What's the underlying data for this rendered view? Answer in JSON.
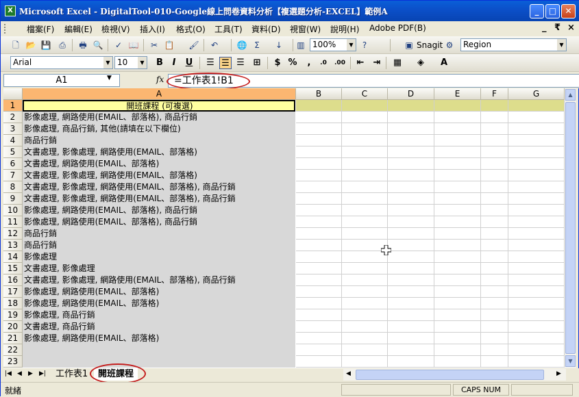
{
  "window": {
    "title": "Microsoft Excel - DigitalTool-010-Google線上問卷資料分析【複選題分析-EXCEL】範例A",
    "app_icon": "excel-icon"
  },
  "menubar": {
    "items": [
      "檔案(F)",
      "編輯(E)",
      "檢視(V)",
      "插入(I)",
      "格式(O)",
      "工具(T)",
      "資料(D)",
      "視窗(W)",
      "說明(H)",
      "Adobe PDF(B)"
    ],
    "right_controls": [
      "_",
      "₹",
      "×"
    ]
  },
  "standard_toolbar": {
    "zoom": "100%",
    "snagit_label": "Snagit",
    "region_combo": "Region"
  },
  "format_toolbar": {
    "font": "Arial",
    "font_size": "10"
  },
  "formula_bar": {
    "name_box": "A1",
    "fx_label": "fx",
    "formula": "=工作表1!B1"
  },
  "grid": {
    "columns": [
      "A",
      "B",
      "C",
      "D",
      "E",
      "F",
      "G"
    ],
    "rows": [
      {
        "num": "1",
        "a": "開班課程 (可複選)"
      },
      {
        "num": "2",
        "a": "影像處理, 網路使用(EMAIL、部落格), 商品行銷"
      },
      {
        "num": "3",
        "a": "影像處理, 商品行銷, 其他(請填在以下欄位)"
      },
      {
        "num": "4",
        "a": "商品行銷"
      },
      {
        "num": "5",
        "a": "文書處理, 影像處理, 網路使用(EMAIL、部落格)"
      },
      {
        "num": "6",
        "a": "文書處理, 網路使用(EMAIL、部落格)"
      },
      {
        "num": "7",
        "a": "文書處理, 影像處理, 網路使用(EMAIL、部落格)"
      },
      {
        "num": "8",
        "a": "文書處理, 影像處理, 網路使用(EMAIL、部落格), 商品行銷"
      },
      {
        "num": "9",
        "a": "文書處理, 影像處理, 網路使用(EMAIL、部落格), 商品行銷"
      },
      {
        "num": "10",
        "a": "影像處理, 網路使用(EMAIL、部落格), 商品行銷"
      },
      {
        "num": "11",
        "a": "影像處理, 網路使用(EMAIL、部落格), 商品行銷"
      },
      {
        "num": "12",
        "a": "商品行銷"
      },
      {
        "num": "13",
        "a": "商品行銷"
      },
      {
        "num": "14",
        "a": "影像處理"
      },
      {
        "num": "15",
        "a": "文書處理, 影像處理"
      },
      {
        "num": "16",
        "a": "文書處理, 影像處理, 網路使用(EMAIL、部落格), 商品行銷"
      },
      {
        "num": "17",
        "a": "影像處理, 網路使用(EMAIL、部落格)"
      },
      {
        "num": "18",
        "a": "影像處理, 網路使用(EMAIL、部落格)"
      },
      {
        "num": "19",
        "a": "影像處理, 商品行銷"
      },
      {
        "num": "20",
        "a": "文書處理, 商品行銷"
      },
      {
        "num": "21",
        "a": "影像處理, 網路使用(EMAIL、部落格)"
      },
      {
        "num": "22",
        "a": ""
      },
      {
        "num": "23",
        "a": ""
      }
    ]
  },
  "sheet_tabs": {
    "tabs": [
      "工作表1",
      "開班課程"
    ],
    "active": "開班課程"
  },
  "statusbar": {
    "status": "就緒",
    "indicators": "CAPS NUM"
  },
  "colors": {
    "selected_header": "#fbb671",
    "header_cell_fill": "#ffffa0",
    "annotation_oval": "#c41e1e",
    "title_bar": "#0b4fc8"
  }
}
